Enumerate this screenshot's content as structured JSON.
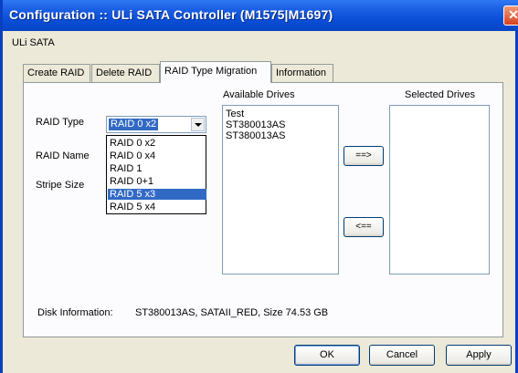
{
  "window": {
    "title": "Configuration :: ULi SATA Controller (M1575|M1697)",
    "close_glyph": "✕",
    "subtitle": "ULi SATA"
  },
  "tabs": [
    {
      "label": "Create RAID"
    },
    {
      "label": "Delete RAID"
    },
    {
      "label": "RAID Type Migration",
      "active": true
    },
    {
      "label": "Information"
    }
  ],
  "form": {
    "raid_type_label": "RAID Type",
    "raid_name_label": "RAID Name",
    "stripe_size_label": "Stripe Size",
    "raid_type_value": "RAID 0 x2",
    "raid_type_options": [
      "RAID 0 x2",
      "RAID 0 x4",
      "RAID 1",
      "RAID 0+1",
      "RAID 5 x3",
      "RAID 5 x4"
    ],
    "raid_type_highlighted": "RAID 5 x3"
  },
  "available_drives": {
    "header": "Available Drives",
    "items": [
      "Test",
      "ST380013AS",
      "ST380013AS"
    ]
  },
  "selected_drives": {
    "header": "Selected Drives",
    "items": []
  },
  "transfer": {
    "add_label": "==>",
    "remove_label": "<=="
  },
  "disk_info": {
    "label": "Disk Information:",
    "value": "ST380013AS, SATAII_RED, Size 74.53 GB"
  },
  "buttons": {
    "ok": "OK",
    "cancel": "Cancel",
    "apply": "Apply"
  },
  "colors": {
    "titlebar": "#0a4ed8",
    "selection": "#316ac5",
    "dialog_bg": "#ece9d8"
  }
}
